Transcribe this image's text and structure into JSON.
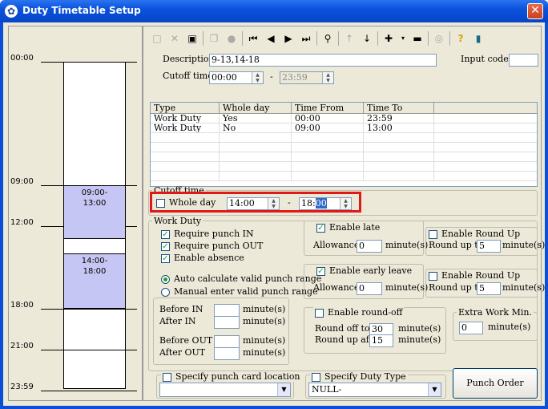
{
  "window": {
    "title": "Duty Timetable Setup",
    "close_label": "✕"
  },
  "timeline": {
    "labels": [
      "00:00",
      "09:00",
      "12:00",
      "18:00",
      "21:00",
      "23:59"
    ],
    "blocks": [
      {
        "from": "09:00-",
        "to": "13:00"
      },
      {
        "from": "14:00-",
        "to": "18:00"
      }
    ]
  },
  "form": {
    "description_label": "Description",
    "description_value": "9-13,14-18",
    "input_code_label": "Input code :",
    "input_code_value": "",
    "cutoff_label": "Cutoff time",
    "cutoff_from": "00:00",
    "cutoff_sep": "-",
    "cutoff_to": "23:59"
  },
  "grid": {
    "headers": [
      "Type",
      "Whole day",
      "Time From",
      "Time To",
      ""
    ],
    "rows": [
      [
        "Work Duty",
        "Yes",
        "00:00",
        "23:59",
        ""
      ],
      [
        "Work Duty",
        "No",
        "09:00",
        "13:00",
        ""
      ]
    ]
  },
  "cutoff_group": {
    "legend": "Cutoff time",
    "whole_day_label": "Whole day",
    "from": "14:00",
    "sep": "-",
    "to_prefix": "18:",
    "to_selected": "00"
  },
  "work_duty": {
    "legend": "Work Duty",
    "require_in": "Require punch IN",
    "require_out": "Require punch OUT",
    "enable_absence": "Enable absence",
    "auto_calc": "Auto calculate valid punch range",
    "manual_enter": "Manual enter valid punch range",
    "before_in": "Before IN",
    "after_in": "After IN",
    "before_out": "Before OUT",
    "after_out": "After OUT",
    "minutes": "minute(s)"
  },
  "late": {
    "enable_late": "Enable late",
    "allowance": "Allowance",
    "allowance_value": "0",
    "minutes": "minute(s)",
    "enable_round_up": "Enable Round Up",
    "round_up_to": "Round up to",
    "round_up_value": "5"
  },
  "early": {
    "enable_early": "Enable early leave",
    "allowance": "Allowance",
    "allowance_value": "0",
    "minutes": "minute(s)",
    "enable_round_up": "Enable Round Up",
    "round_up_to": "Round up to",
    "round_up_value": "5"
  },
  "roundoff": {
    "enable": "Enable round-off",
    "round_off_to": "Round off to",
    "round_off_value": "30",
    "round_up_after": "Round up after",
    "round_up_after_value": "15",
    "minutes": "minute(s)"
  },
  "extra": {
    "legend": "Extra Work Min.",
    "value": "0",
    "minutes": "minute(s)"
  },
  "bottom": {
    "punch_location": "Specify punch card location",
    "punch_location_value": "",
    "duty_type": "Specify Duty Type",
    "duty_type_value": "NULL-",
    "punch_order": "Punch Order"
  },
  "toolbar_icons": [
    "new-icon",
    "delete-icon",
    "save-icon",
    "copy-icon",
    "record-icon",
    "first-icon",
    "prev-icon",
    "next-icon",
    "last-icon",
    "find-icon",
    "up-icon",
    "down-icon",
    "add-icon",
    "remove-icon",
    "disabled-icon",
    "help-icon",
    "exit-icon"
  ]
}
